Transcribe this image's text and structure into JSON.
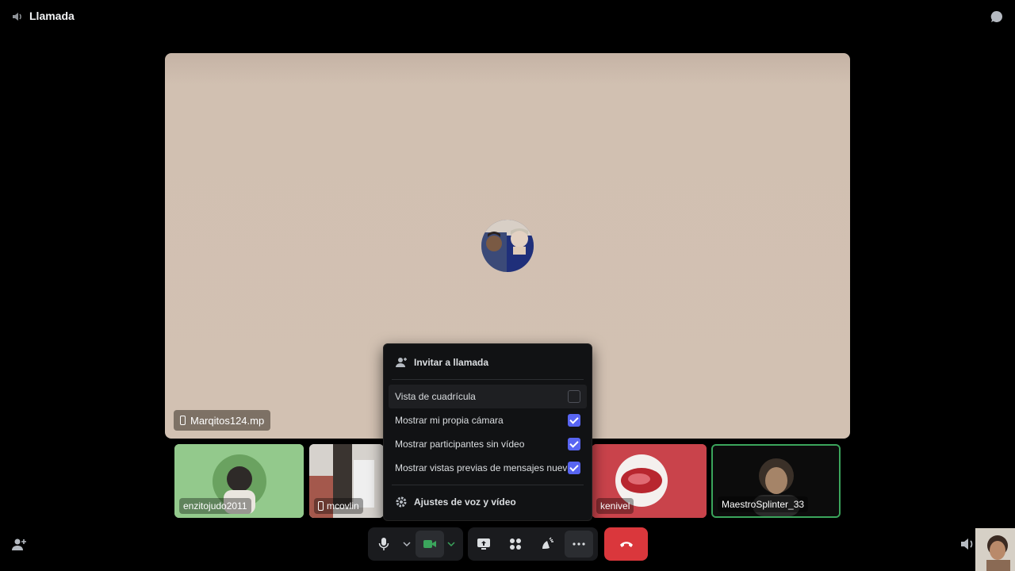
{
  "window": {
    "title": "Llamada"
  },
  "stage": {
    "participant": "Marqitos124.mp"
  },
  "tiles": [
    {
      "name": "enzitojudo2011"
    },
    {
      "name": "mcovlin"
    },
    {
      "name": "kenivel"
    },
    {
      "name": "MaestroSplinter_33"
    }
  ],
  "menu": {
    "invite": "Invitar a llamada",
    "options": [
      {
        "label": "Vista de cuadrícula",
        "checked": false
      },
      {
        "label": "Mostrar mi propia cámara",
        "checked": true
      },
      {
        "label": "Mostrar participantes sin vídeo",
        "checked": true
      },
      {
        "label": "Mostrar vistas previas de mensajes nuevos",
        "checked": true
      }
    ],
    "settings": "Ajustes de voz y vídeo"
  },
  "colors": {
    "accent": "#5865f2",
    "end_call": "#da373c",
    "speaking": "#3ba55c"
  },
  "icons": [
    "speaker-icon",
    "chat-icon",
    "microphone-icon",
    "camera-icon",
    "screen-share-icon",
    "activities-icon",
    "soundboard-icon",
    "more-icon",
    "hangup-icon",
    "add-person-icon",
    "gear-icon",
    "volume-icon"
  ]
}
